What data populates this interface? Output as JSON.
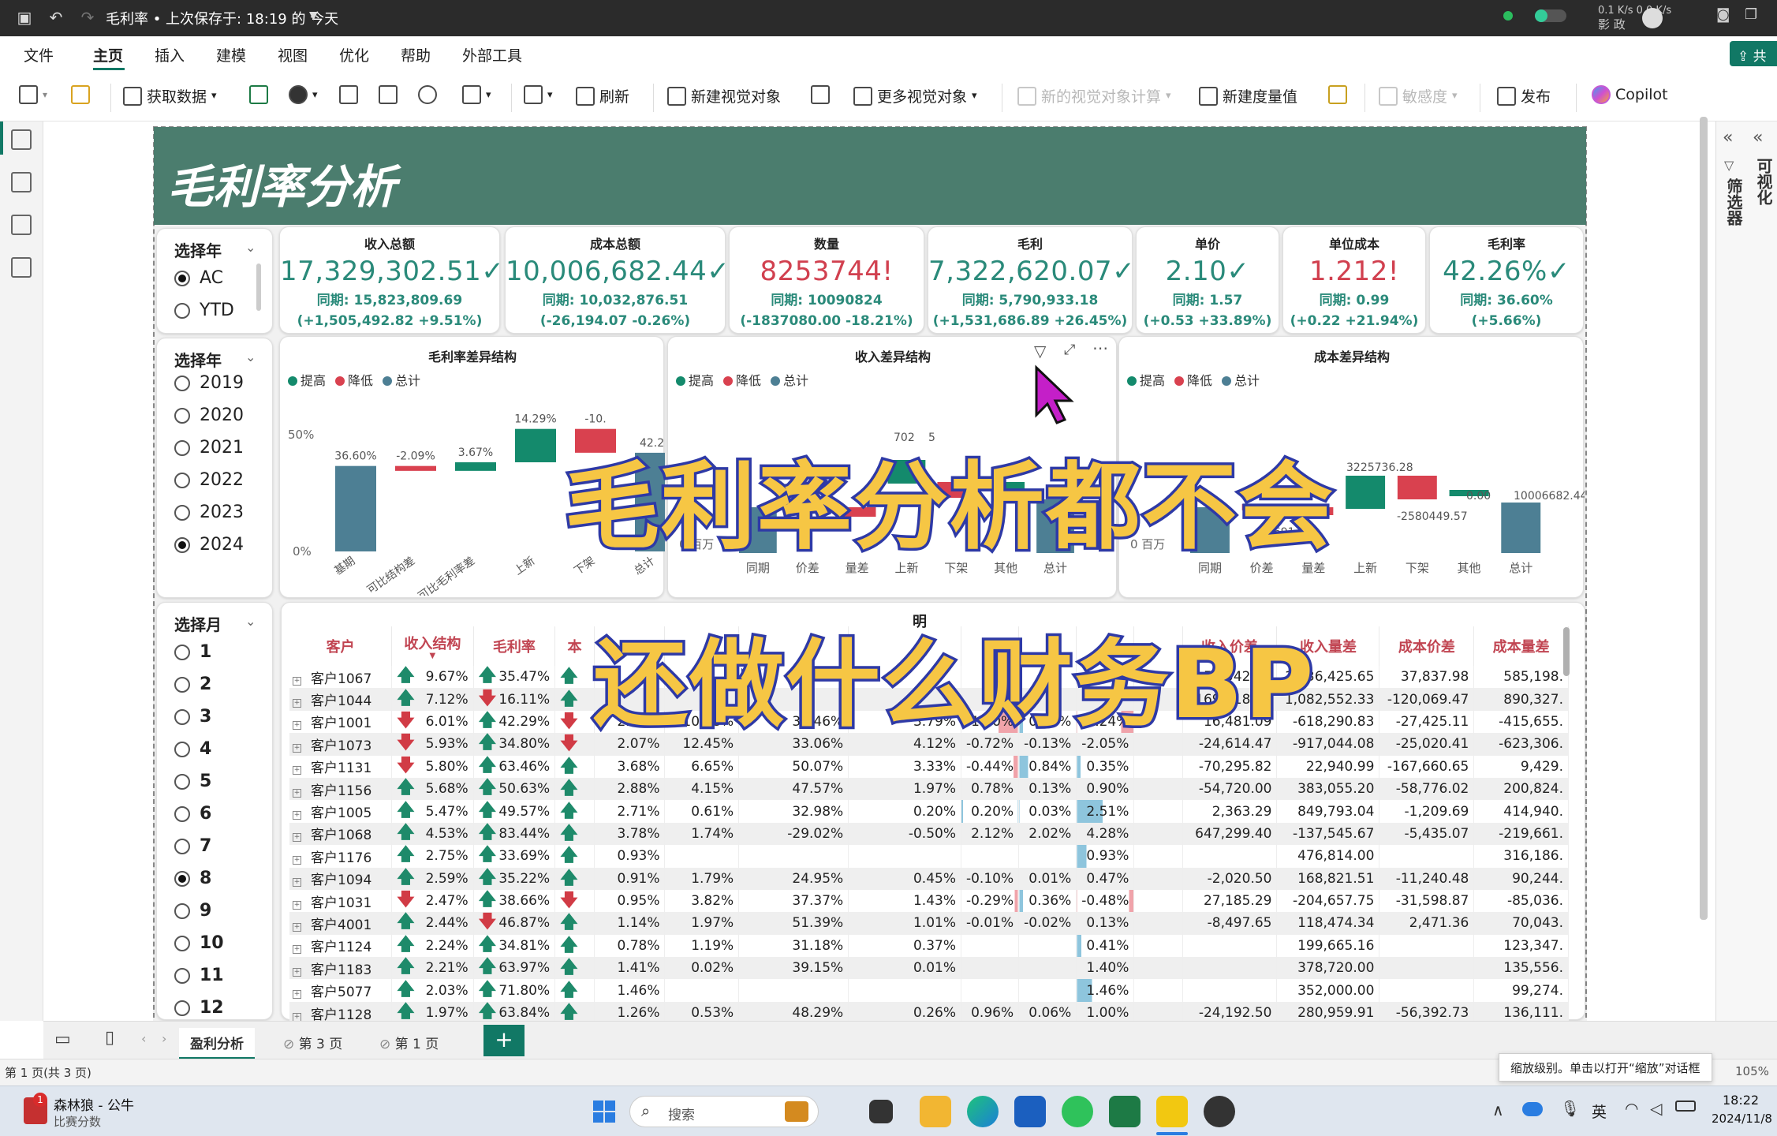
{
  "titlebar": {
    "title": "毛利率 • 上次保存于: 18:19 的 今天",
    "speed": "0.1 K/s  0.0 K/s",
    "tray_text": "影 政"
  },
  "menu": {
    "items": [
      "文件",
      "主页",
      "插入",
      "建模",
      "视图",
      "优化",
      "帮助",
      "外部工具"
    ],
    "share": "共"
  },
  "ribbon": {
    "get_data": "获取数据",
    "refresh": "刷新",
    "new_visual": "新建视觉对象",
    "more_visuals": "更多视觉对象",
    "new_visual_calc": "新的视觉对象计算",
    "new_measure": "新建度量值",
    "sensitivity": "敏感度",
    "publish": "发布",
    "copilot": "Copilot"
  },
  "right_panel": {
    "filters": "筛选器",
    "visualize": "可视化"
  },
  "report": {
    "title": "毛利率分析"
  },
  "slicer_type": {
    "title": "选择年",
    "options": [
      "AC",
      "YTD"
    ],
    "selected": "AC"
  },
  "slicer_year": {
    "title": "选择年",
    "options": [
      "2019",
      "2020",
      "2021",
      "2022",
      "2023",
      "2024"
    ],
    "selected": "2024"
  },
  "slicer_month": {
    "title": "选择月",
    "options": [
      "1",
      "2",
      "3",
      "4",
      "5",
      "6",
      "7",
      "8",
      "9",
      "10",
      "11",
      "12"
    ],
    "selected": "8"
  },
  "kpis": [
    {
      "label": "收入总额",
      "value": "17,329,302.51",
      "mark": "✓",
      "prior": "同期: 15,823,809.69",
      "diff": "(+1,505,492.82 +9.51%)",
      "red": false
    },
    {
      "label": "成本总额",
      "value": "10,006,682.44",
      "mark": "✓",
      "prior": "同期: 10,032,876.51",
      "diff": "(-26,194.07 -0.26%)",
      "red": false
    },
    {
      "label": "数量",
      "value": "8253744",
      "mark": "!",
      "prior": "同期: 10090824",
      "diff": "(-1837080.00 -18.21%)",
      "red": true
    },
    {
      "label": "毛利",
      "value": "7,322,620.07",
      "mark": "✓",
      "prior": "同期: 5,790,933.18",
      "diff": "(+1,531,686.89 +26.45%)",
      "red": false
    },
    {
      "label": "单价",
      "value": "2.10",
      "mark": "✓",
      "prior": "同期: 1.57",
      "diff": "(+0.53 +33.89%)",
      "red": false
    },
    {
      "label": "单位成本",
      "value": "1.212",
      "mark": "!",
      "prior": "同期: 0.99",
      "diff": "(+0.22 +21.94%)",
      "red": true
    },
    {
      "label": "毛利率",
      "value": "42.26%",
      "mark": "✓",
      "prior": "同期: 36.60%",
      "diff": "(+5.66%)",
      "red": false
    }
  ],
  "legend": {
    "up": "提高",
    "down": "降低",
    "total": "总计"
  },
  "colors": {
    "up": "#148a6c",
    "down": "#d9414f",
    "total": "#4d7f94",
    "accent": "#117865",
    "banner": "#4b7d6e"
  },
  "chart_data": [
    {
      "type": "waterfall",
      "title": "毛利率差异结构",
      "categories": [
        "基期",
        "可比结构差",
        "可比毛利率差",
        "上新",
        "下架",
        "总计"
      ],
      "values": [
        36.6,
        -2.09,
        3.67,
        14.29,
        -10.2,
        42.26
      ],
      "kinds": [
        "total",
        "down",
        "up",
        "up",
        "down",
        "total"
      ],
      "data_labels": [
        "36.60%",
        "-2.09%",
        "3.67%",
        "14.29%",
        "-10.",
        "42.26"
      ],
      "yticks": [
        "50%",
        "0%"
      ]
    },
    {
      "type": "waterfall",
      "title": "收入差异结构",
      "categories": [
        "同期",
        "价差",
        "量差",
        "上新",
        "下架",
        "其他",
        "总计"
      ],
      "kinds": [
        "total",
        "up",
        "down",
        "up",
        "down",
        "up",
        "total"
      ],
      "data_labels": [
        "702",
        "5"
      ],
      "yticks": [
        "0 百万"
      ]
    },
    {
      "type": "waterfall",
      "title": "成本差异结构",
      "categories": [
        "同期",
        "价差",
        "量差",
        "上新",
        "下架",
        "其他",
        "总计"
      ],
      "kinds": [
        "total",
        "down",
        "down",
        "up",
        "down",
        "up",
        "total"
      ],
      "data_labels": [
        "876.51",
        "58691.07",
        "3225736.28",
        "-2580449.57",
        "0.00",
        "10006682.44"
      ],
      "yticks": [
        "0 百万"
      ]
    }
  ],
  "table": {
    "columns": [
      "客户",
      "收入结构",
      "毛利率",
      "本",
      "",
      "",
      "",
      "",
      "",
      "",
      "",
      "",
      "收入价差",
      "收入量差",
      "成本价差",
      "成本量差"
    ],
    "header_partial": "明",
    "rows": [
      {
        "c": "客户1067",
        "a1": "up",
        "s": "9.67%",
        "a2": "up",
        "m": "35.47%",
        "a3": "up",
        "v": [
          "",
          "",
          "",
          "",
          "",
          "",
          "",
          ""
        ],
        "ip": "-58,542.66",
        "iq": "1,036,425.65",
        "cp": "37,837.98",
        "cq": "585,198."
      },
      {
        "c": "客户1044",
        "a1": "up",
        "s": "7.12%",
        "a2": "dn",
        "m": "16.11%",
        "a3": "up",
        "v": [
          "",
          "",
          "",
          "",
          "",
          "",
          "",
          ""
        ],
        "ip": "-169,318.73",
        "iq": "1,082,552.33",
        "cp": "-120,069.47",
        "cq": "890,327."
      },
      {
        "c": "客户1001",
        "a1": "dn",
        "s": "6.01%",
        "a2": "up",
        "m": "42.29%",
        "a3": "dn",
        "v": [
          "2.54%",
          "10.38%",
          "36.46%",
          "3.79%",
          "-1.90%",
          "0.36%",
          "-1.24%"
        ],
        "ip": "16,481.09",
        "iq": "-618,290.83",
        "cp": "-27,425.11",
        "cq": "-415,655."
      },
      {
        "c": "客户1073",
        "a1": "dn",
        "s": "5.93%",
        "a2": "up",
        "m": "34.80%",
        "a3": "dn",
        "v": [
          "2.07%",
          "12.45%",
          "33.06%",
          "4.12%",
          "-0.72%",
          "-0.13%",
          "-2.05%"
        ],
        "ip": "-24,614.47",
        "iq": "-917,044.08",
        "cp": "-25,020.41",
        "cq": "-623,306."
      },
      {
        "c": "客户1131",
        "a1": "dn",
        "s": "5.80%",
        "a2": "up",
        "m": "63.46%",
        "a3": "up",
        "v": [
          "3.68%",
          "6.65%",
          "50.07%",
          "3.33%",
          "-0.44%",
          "0.84%",
          "0.35%"
        ],
        "ip": "-70,295.82",
        "iq": "22,940.99",
        "cp": "-167,660.65",
        "cq": "9,429."
      },
      {
        "c": "客户1156",
        "a1": "up",
        "s": "5.68%",
        "a2": "up",
        "m": "50.63%",
        "a3": "up",
        "v": [
          "2.88%",
          "4.15%",
          "47.57%",
          "1.97%",
          "0.78%",
          "0.13%",
          "0.90%"
        ],
        "ip": "-54,720.00",
        "iq": "383,055.20",
        "cp": "-58,776.02",
        "cq": "200,824."
      },
      {
        "c": "客户1005",
        "a1": "up",
        "s": "5.47%",
        "a2": "up",
        "m": "49.57%",
        "a3": "up",
        "v": [
          "2.71%",
          "0.61%",
          "32.98%",
          "0.20%",
          "0.20%",
          "0.03%",
          "2.51%"
        ],
        "ip": "2,363.29",
        "iq": "849,793.04",
        "cp": "-1,209.69",
        "cq": "414,940."
      },
      {
        "c": "客户1068",
        "a1": "up",
        "s": "4.53%",
        "a2": "up",
        "m": "83.44%",
        "a3": "up",
        "v": [
          "3.78%",
          "1.74%",
          "-29.02%",
          "-0.50%",
          "2.12%",
          "2.02%",
          "4.28%"
        ],
        "ip": "647,299.40",
        "iq": "-137,545.67",
        "cp": "-5,435.07",
        "cq": "-219,661."
      },
      {
        "c": "客户1176",
        "a1": "up",
        "s": "2.75%",
        "a2": "up",
        "m": "33.69%",
        "a3": "up",
        "v": [
          "0.93%",
          "",
          "",
          "",
          "",
          "",
          "0.93%"
        ],
        "ip": "",
        "iq": "476,814.00",
        "cp": "",
        "cq": "316,186."
      },
      {
        "c": "客户1094",
        "a1": "up",
        "s": "2.59%",
        "a2": "up",
        "m": "35.22%",
        "a3": "up",
        "v": [
          "0.91%",
          "1.79%",
          "24.95%",
          "0.45%",
          "-0.10%",
          "0.01%",
          "0.47%"
        ],
        "ip": "-2,020.50",
        "iq": "168,821.51",
        "cp": "-11,240.48",
        "cq": "90,244."
      },
      {
        "c": "客户1031",
        "a1": "dn",
        "s": "2.47%",
        "a2": "up",
        "m": "38.66%",
        "a3": "dn",
        "v": [
          "0.95%",
          "3.82%",
          "37.37%",
          "1.43%",
          "-0.29%",
          "0.36%",
          "-0.48%"
        ],
        "ip": "27,185.29",
        "iq": "-204,657.75",
        "cp": "-31,598.87",
        "cq": "-85,036."
      },
      {
        "c": "客户4001",
        "a1": "up",
        "s": "2.44%",
        "a2": "dn",
        "m": "46.87%",
        "a3": "up",
        "v": [
          "1.14%",
          "1.97%",
          "51.39%",
          "1.01%",
          "-0.01%",
          "-0.02%",
          "0.13%"
        ],
        "ip": "-8,497.65",
        "iq": "118,474.34",
        "cp": "2,471.36",
        "cq": "70,043."
      },
      {
        "c": "客户1124",
        "a1": "up",
        "s": "2.24%",
        "a2": "up",
        "m": "34.81%",
        "a3": "up",
        "v": [
          "0.78%",
          "1.19%",
          "31.18%",
          "0.37%",
          "",
          "",
          "0.41%"
        ],
        "ip": "",
        "iq": "199,665.16",
        "cp": "",
        "cq": "123,347."
      },
      {
        "c": "客户1183",
        "a1": "up",
        "s": "2.21%",
        "a2": "up",
        "m": "63.97%",
        "a3": "up",
        "v": [
          "1.41%",
          "0.02%",
          "39.15%",
          "0.01%",
          "",
          "",
          "1.40%"
        ],
        "ip": "",
        "iq": "378,720.00",
        "cp": "",
        "cq": "135,556."
      },
      {
        "c": "客户5077",
        "a1": "up",
        "s": "2.03%",
        "a2": "up",
        "m": "71.80%",
        "a3": "up",
        "v": [
          "1.46%",
          "",
          "",
          "",
          "",
          "",
          "1.46%"
        ],
        "ip": "",
        "iq": "352,000.00",
        "cp": "",
        "cq": "99,274."
      },
      {
        "c": "客户1128",
        "a1": "up",
        "s": "1.97%",
        "a2": "up",
        "m": "63.84%",
        "a3": "up",
        "v": [
          "1.26%",
          "0.53%",
          "48.29%",
          "0.26%",
          "0.96%",
          "0.06%",
          "1.00%"
        ],
        "ip": "-24,192.50",
        "iq": "280,959.91",
        "cp": "-56,392.73",
        "cq": "136,111."
      }
    ]
  },
  "overlay": {
    "line1": "毛利率分析都不会",
    "line2": "还做什么财务BP"
  },
  "page_tabs": {
    "tabs": [
      "盈利分析",
      "第 3 页",
      "第 1 页"
    ],
    "active": "盈利分析",
    "add": "+"
  },
  "status": {
    "page": "第 1 页(共 3 页)",
    "zoom_tip": "缩放级别。单击以打开“缩放”对话框",
    "zoom": "105%"
  },
  "taskbar": {
    "user": "森林狼 - 公牛",
    "user_sub": "比赛分数",
    "badge": "1",
    "search": "搜索",
    "ime": "英",
    "time": "18:22",
    "date": "2024/11/8"
  }
}
